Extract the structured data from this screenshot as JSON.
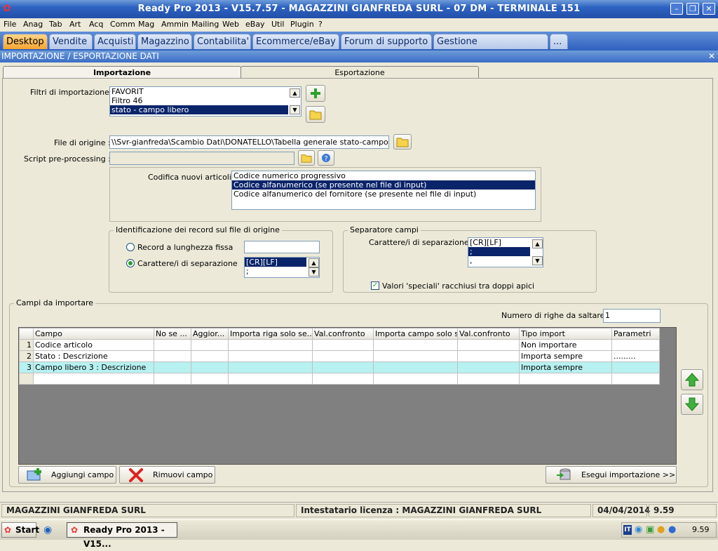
{
  "window": {
    "title": "Ready Pro 2013 - V15.7.57 - MAGAZZINI GIANFREDA SURL - 07 DM - TERMINALE 151",
    "controls": {
      "minimize": "–",
      "restore": "❐",
      "close": "✕"
    }
  },
  "menu": [
    "File",
    "Anag",
    "Tab",
    "Art",
    "Acq",
    "Comm",
    "Mag",
    "Ammin",
    "Mailing",
    "Web",
    "eBay",
    "Util",
    "Plugin",
    "?"
  ],
  "tabs": [
    "Desktop",
    "Vendite",
    "Acquisti",
    "Magazzino",
    "Contabilita'",
    "Ecommerce/eBay",
    "Forum di supporto",
    "Gestione messaggistica",
    "..."
  ],
  "section": {
    "title": "IMPORTAZIONE / ESPORTAZIONE DATI",
    "close": "✕"
  },
  "subtabs": {
    "import": "Importazione",
    "export": "Esportazione"
  },
  "filters": {
    "label": "Filtri di importazione :",
    "items": [
      "FAVORIT",
      "Filtro 46",
      "stato - campo libero"
    ],
    "selected": "stato - campo libero"
  },
  "source_file": {
    "label": "File di origine :",
    "value": "\\\\Svr-gianfreda\\Scambio Dati\\DONATELLO\\Tabella generale stato-campo libero.csv"
  },
  "script": {
    "label": "Script pre-processing :",
    "value": ""
  },
  "encoding": {
    "label": "Codifica nuovi articoli :",
    "items": [
      "Codice numerico progressivo",
      "Codice alfanumerico (se presente nel file di input)",
      "Codice alfanumerico del fornitore (se presente nel file di input)"
    ],
    "selected": "Codice alfanumerico (se presente nel file di input)"
  },
  "record_id": {
    "title": "Identificazione dei record sul file di origine",
    "fixed_label": "Record a lunghezza fissa",
    "fixed_value": "",
    "sep_label": "Carattere/i di separazione",
    "sep_items": [
      "[CR][LF]",
      ";"
    ],
    "sep_selected": "[CR][LF]",
    "selected_option": "sep"
  },
  "field_sep": {
    "title": "Separatore campi",
    "label": "Carattere/i di separazione",
    "items": [
      "[CR][LF]",
      ";",
      ","
    ],
    "selected": ";",
    "quotes_label": "Valori 'speciali' racchiusi tra doppi apici",
    "quotes_checked": true
  },
  "fields": {
    "title": "Campi da importare",
    "skip_label": "Numero di righe da saltare :",
    "skip_value": "1",
    "columns": [
      "Campo",
      "No se ...",
      "Aggior...",
      "Importa riga solo se...",
      "Val.confronto",
      "Importa campo solo s...",
      "Val.confronto",
      "Tipo import",
      "Parametri"
    ],
    "rows": [
      [
        "1",
        "Codice articolo",
        "",
        "",
        "",
        "",
        "",
        "",
        "Non importare",
        ""
      ],
      [
        "2",
        "Stato : Descrizione",
        "",
        "",
        "",
        "",
        "",
        "",
        "Importa sempre",
        "........."
      ],
      [
        "3",
        "Campo libero 3 : Descrizione",
        "",
        "",
        "",
        "",
        "",
        "",
        "Importa sempre",
        ""
      ],
      [
        "",
        "",
        "",
        "",
        "",
        "",
        "",
        "",
        "",
        ""
      ]
    ],
    "highlighted_row": 2
  },
  "buttons": {
    "add_field": "Aggiungi campo",
    "remove_field": "Rimuovi campo",
    "run_import": "Esegui importazione >>"
  },
  "status_bar": {
    "company": "MAGAZZINI GIANFREDA SURL",
    "license": "Intestatario licenza : MAGAZZINI GIANFREDA SURL",
    "date": "04/04/2014",
    "time": "9.59"
  },
  "taskbar": {
    "start": "Start",
    "item": "Ready Pro 2013 - V15...",
    "lang": "IT",
    "clock": "9.59"
  },
  "colors": {
    "selection": "#0a246a",
    "highlight_row": "#b7f1f1",
    "active_tab": "#f5a531",
    "titlebar": "#2d62c2"
  }
}
